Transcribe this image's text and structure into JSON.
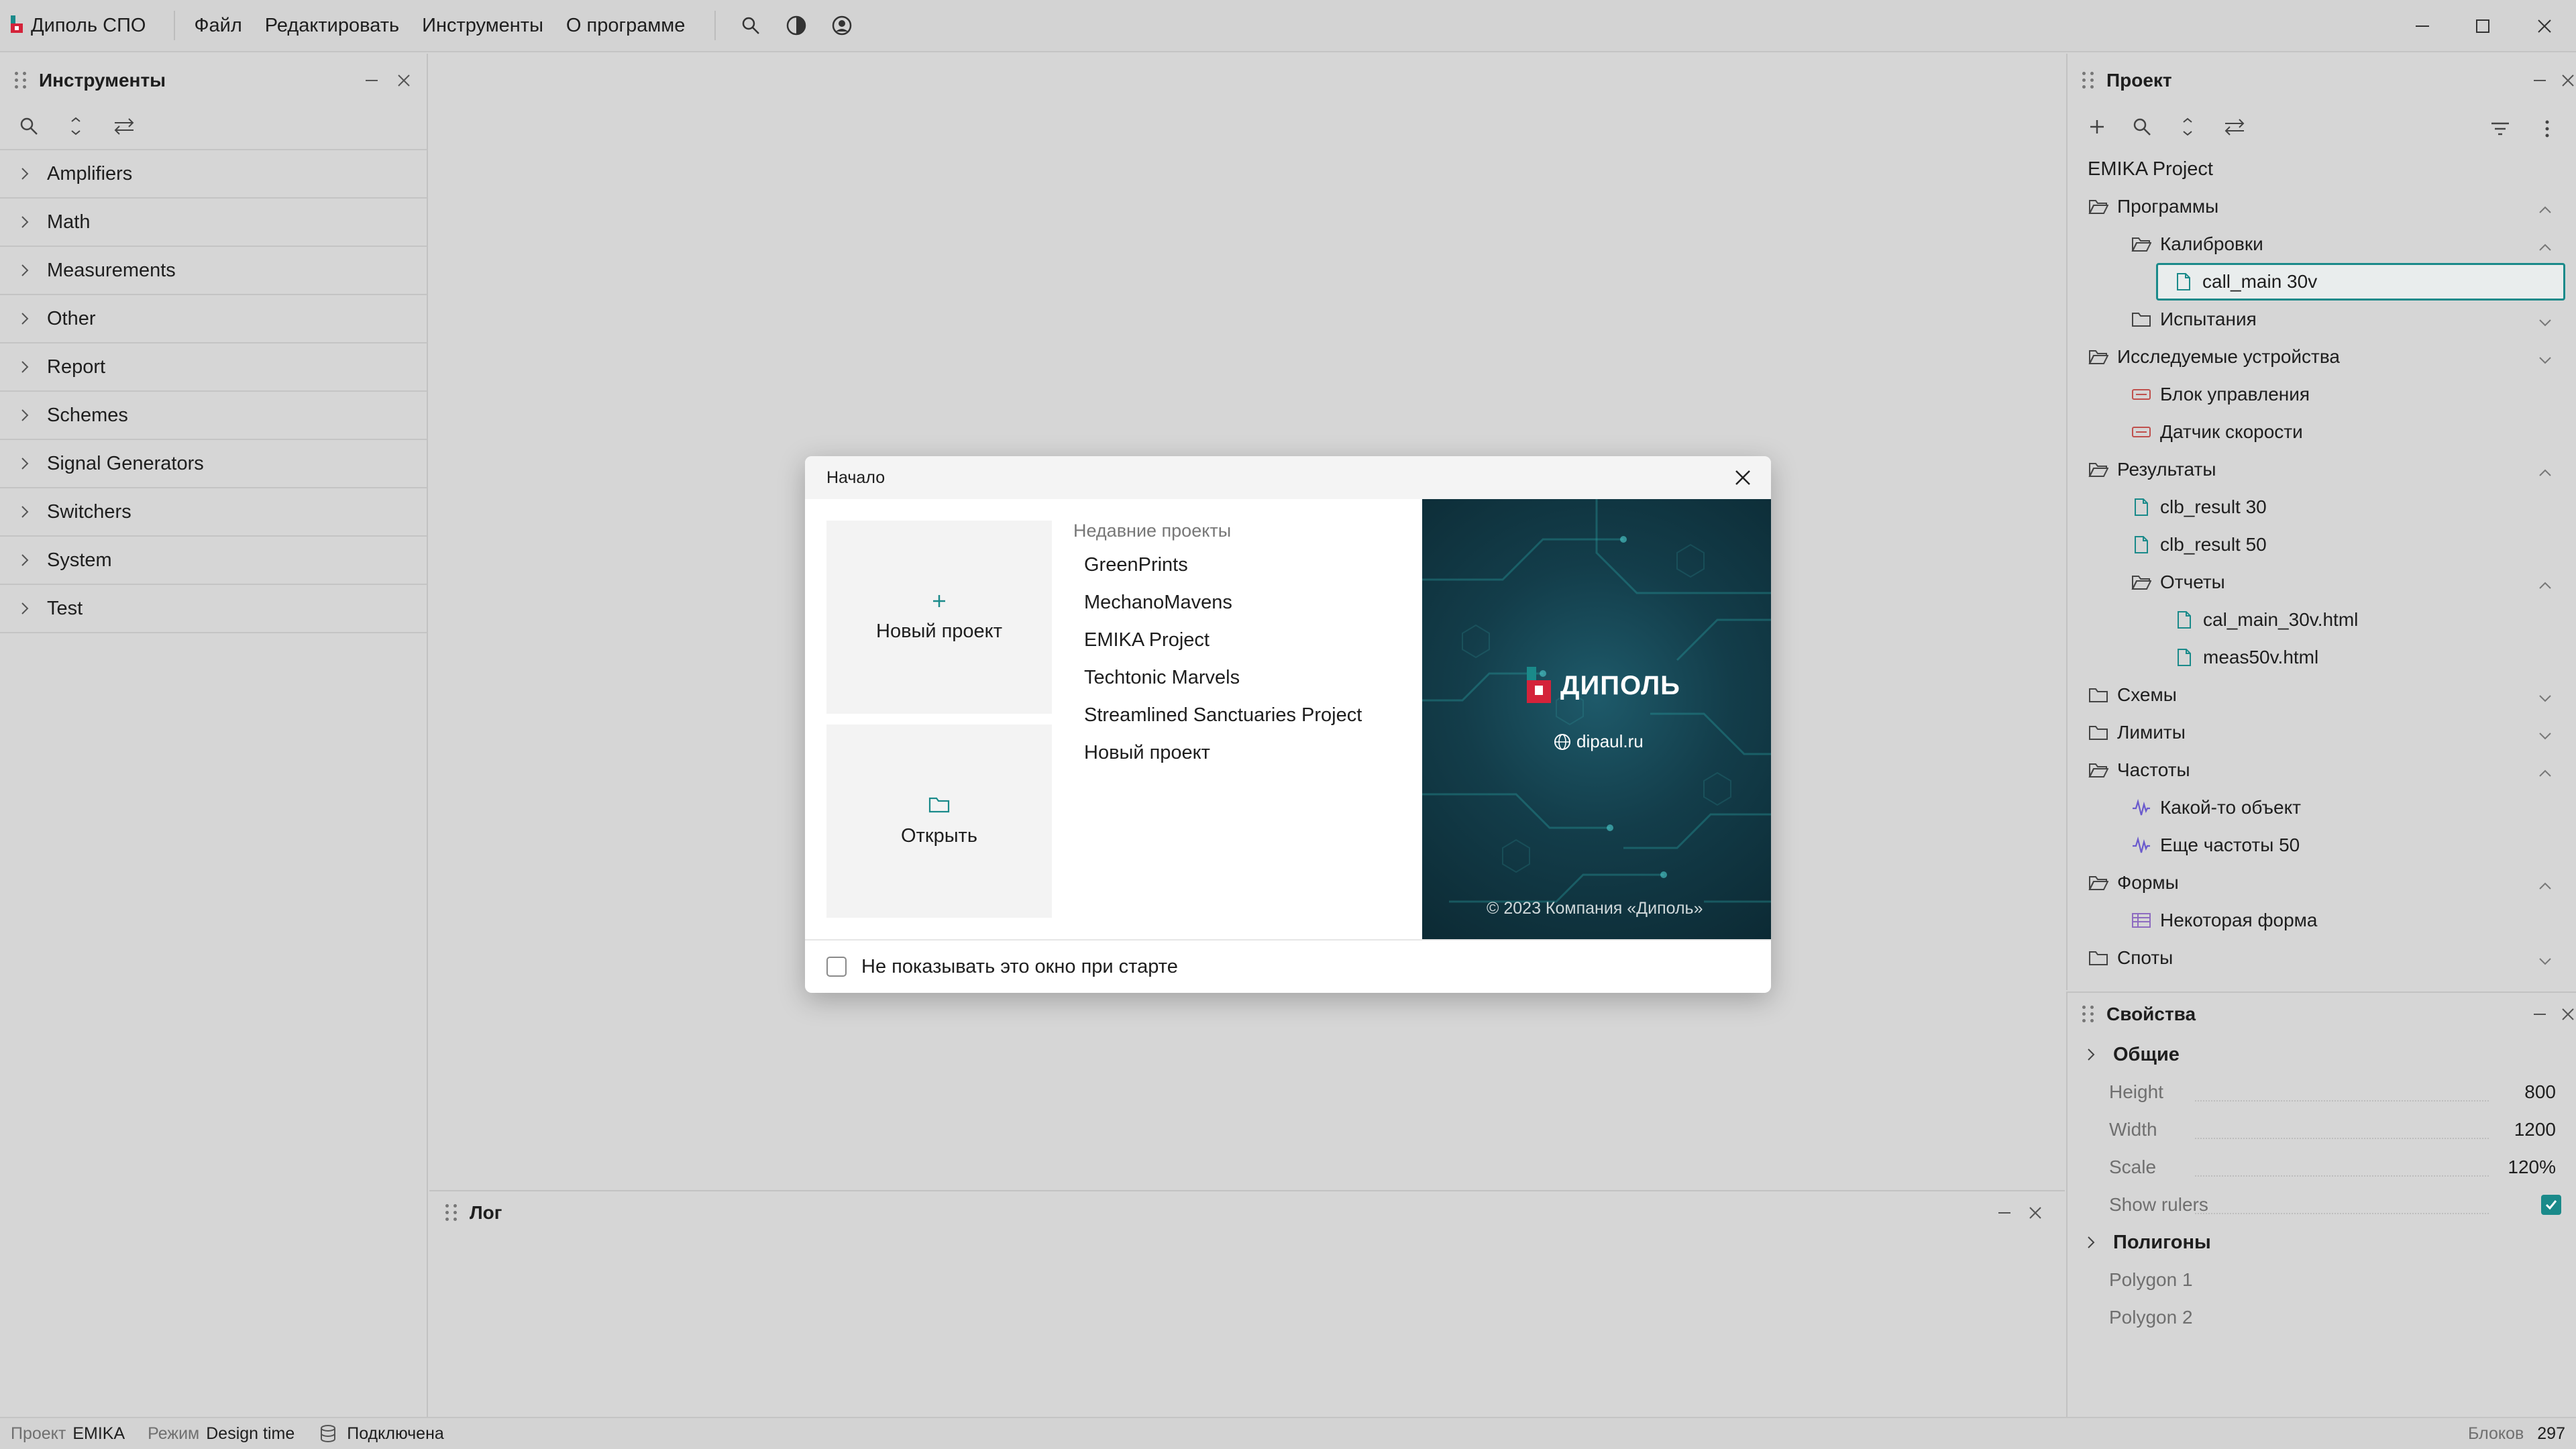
{
  "app": {
    "title": "Диполь СПО",
    "menu": [
      "Файл",
      "Редактировать",
      "Инструменты",
      "О программе"
    ]
  },
  "tools_panel": {
    "title": "Инструменты",
    "items": [
      "Amplifiers",
      "Math",
      "Measurements",
      "Other",
      "Report",
      "Schemes",
      "Signal Generators",
      "Switchers",
      "System",
      "Test"
    ]
  },
  "project_panel": {
    "title": "Проект",
    "root": "EMIKA Project",
    "tree": [
      {
        "label": "Программы",
        "icon": "folder-open-icon",
        "level": 0,
        "toggle": "up"
      },
      {
        "label": "Калибровки",
        "icon": "folder-open-icon",
        "level": 1,
        "toggle": "up"
      },
      {
        "label": "call_main 30v",
        "icon": "file-icon",
        "level": 2,
        "selected": true
      },
      {
        "label": "Испытания",
        "icon": "folder-icon",
        "level": 1,
        "toggle": "down"
      },
      {
        "label": "Исследуемые устройства",
        "icon": "folder-open-icon",
        "level": 0,
        "toggle": "down"
      },
      {
        "label": "Блок управления",
        "icon": "device-icon",
        "level": 1
      },
      {
        "label": "Датчик скорости",
        "icon": "device-icon",
        "level": 1
      },
      {
        "label": "Результаты",
        "icon": "folder-open-icon",
        "level": 0,
        "toggle": "up"
      },
      {
        "label": "clb_result 30",
        "icon": "file-icon",
        "level": 1
      },
      {
        "label": "clb_result 50",
        "icon": "file-icon",
        "level": 1
      },
      {
        "label": "Отчеты",
        "icon": "folder-open-icon",
        "level": 1,
        "toggle": "up"
      },
      {
        "label": "cal_main_30v.html",
        "icon": "file-icon",
        "level": 2
      },
      {
        "label": "meas50v.html",
        "icon": "file-icon",
        "level": 2
      },
      {
        "label": "Схемы",
        "icon": "folder-icon",
        "level": 0,
        "toggle": "down"
      },
      {
        "label": "Лимиты",
        "icon": "folder-icon",
        "level": 0,
        "toggle": "down"
      },
      {
        "label": "Частоты",
        "icon": "folder-open-icon",
        "level": 0,
        "toggle": "up"
      },
      {
        "label": "Какой-то объект",
        "icon": "waveform-icon",
        "level": 1
      },
      {
        "label": "Еще частоты 50",
        "icon": "waveform-icon",
        "level": 1
      },
      {
        "label": "Формы",
        "icon": "folder-open-icon",
        "level": 0,
        "toggle": "up"
      },
      {
        "label": "Некоторая форма",
        "icon": "form-icon",
        "level": 1
      },
      {
        "label": "Споты",
        "icon": "folder-icon",
        "level": 0,
        "toggle": "down"
      }
    ]
  },
  "properties_panel": {
    "title": "Свойства",
    "section_general": "Общие",
    "props": [
      {
        "name": "Height",
        "value": "800"
      },
      {
        "name": "Width",
        "value": "1200"
      },
      {
        "name": "Scale",
        "value": "120%"
      },
      {
        "name": "Show rulers",
        "checked": true
      }
    ],
    "section_polygons": "Полигоны",
    "polygons": [
      "Polygon 1",
      "Polygon 2"
    ]
  },
  "log_panel": {
    "title": "Лог"
  },
  "status": {
    "project_label": "Проект",
    "project_value": "EMIKA",
    "mode_label": "Режим",
    "mode_value": "Design time",
    "connection": "Подключена",
    "blocks_label": "Блоков",
    "blocks_value": "297"
  },
  "dialog": {
    "title": "Начало",
    "new_project": "Новый проект",
    "open": "Открыть",
    "recent_title": "Недавние проекты",
    "recent": [
      "GreenPrints",
      "MechanoMavens",
      "EMIKA Project",
      "Techtonic Marvels",
      "Streamlined Sanctuaries Project",
      "Новый проект"
    ],
    "brand": "ДИПОЛЬ",
    "site": "dipaul.ru",
    "copyright": "© 2023 Компания «Диполь»",
    "dont_show": "Не показывать это окно при старте"
  },
  "colors": {
    "accent": "#1a8a8a",
    "brand_red": "#d4233a",
    "device_red": "#c0504d",
    "waveform": "#6a5acd"
  }
}
